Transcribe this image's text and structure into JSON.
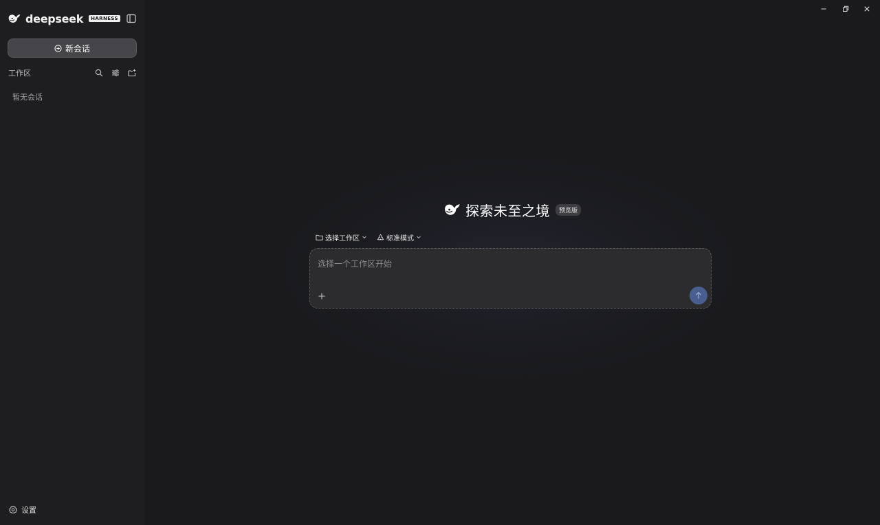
{
  "sidebar": {
    "brand_name": "deepseek",
    "brand_badge": "HARNESS",
    "new_chat_label": "新会话",
    "workspace_label": "工作区",
    "empty_label": "暂无会话",
    "settings_label": "设置"
  },
  "main": {
    "hero_title": "探索未至之境",
    "hero_badge": "预览版",
    "workspace_select_label": "选择工作区",
    "mode_select_label": "标准模式",
    "composer_placeholder": "选择一个工作区开始",
    "composer_value": ""
  },
  "icons": {
    "brand": "whale-logo-icon",
    "collapse": "sidebar-toggle-icon",
    "new_chat": "plus-circle-icon",
    "search": "search-icon",
    "filter": "sliders-icon",
    "new_folder": "folder-plus-icon",
    "settings": "gear-icon",
    "folder": "folder-icon",
    "mode": "recycle-icon",
    "chevron": "chevron-down-icon",
    "attach": "plus-icon",
    "send": "arrow-up-icon",
    "minimize": "minimize-icon",
    "restore": "restore-icon",
    "close": "close-icon"
  },
  "colors": {
    "background": "#1a1a1c",
    "sidebar": "#1e1e20",
    "new_chat_button": "#46464a",
    "composer": "#2c2c2f",
    "send_button": "#4a5f8f"
  }
}
